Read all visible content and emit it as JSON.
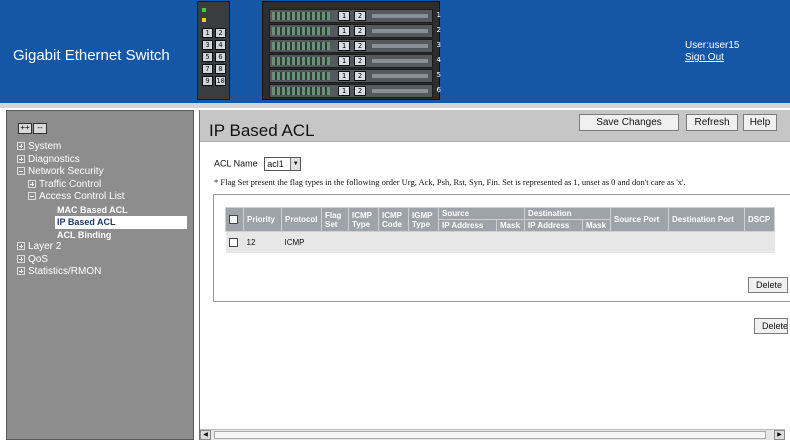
{
  "header": {
    "app_title": "Gigabit Ethernet Switch",
    "user_label": "User:user15",
    "sign_out": "Sign Out",
    "small_switch_ports": [
      "1",
      "2",
      "3",
      "4",
      "5",
      "6",
      "7",
      "8",
      "9",
      "10"
    ],
    "big_switch_slots": [
      "1",
      "2",
      "3",
      "4",
      "5",
      "6"
    ]
  },
  "nav": {
    "expand_all": "++",
    "collapse_all": "--",
    "items": [
      {
        "label": "System",
        "level": 0,
        "expander": "plus"
      },
      {
        "label": "Diagnostics",
        "level": 0,
        "expander": "plus"
      },
      {
        "label": "Network Security",
        "level": 0,
        "expander": "minus"
      },
      {
        "label": "Traffic Control",
        "level": 1,
        "expander": "plus"
      },
      {
        "label": "Access Control List",
        "level": 1,
        "expander": "minus"
      },
      {
        "label": "MAC Based ACL",
        "level": 2
      },
      {
        "label": "IP Based ACL",
        "level": 2,
        "selected": true
      },
      {
        "label": "ACL Binding",
        "level": 2
      },
      {
        "label": "Layer 2",
        "level": 0,
        "expander": "plus"
      },
      {
        "label": "QoS",
        "level": 0,
        "expander": "plus"
      },
      {
        "label": "Statistics/RMON",
        "level": 0,
        "expander": "plus"
      }
    ]
  },
  "main": {
    "page_title": "IP Based ACL",
    "buttons": {
      "save": "Save Changes",
      "refresh": "Refresh",
      "help": "Help"
    },
    "acl_name_label": "ACL Name",
    "acl_name_value": "acl1",
    "note": "* Flag Set present the flag types in the following order Urg, Ack, Psh, Rst, Syn, Fin. Set is represented as 1, unset as 0 and don't care as 'x'.",
    "table": {
      "headers": {
        "priority": "Priority",
        "protocol": "Protocol",
        "flag_set": "Flag Set",
        "icmp_type": "ICMP Type",
        "icmp_code": "ICMP Code",
        "igmp_type": "IGMP Type",
        "source": "Source",
        "destination": "Destination",
        "source_port": "Source Port",
        "destination_port": "Destination Port",
        "dscp": "DSCP",
        "src_ip": "IP Address",
        "src_mask": "Mask",
        "dst_ip": "IP Address",
        "dst_mask": "Mask"
      },
      "rows": [
        {
          "priority": "12",
          "protocol": "ICMP",
          "flag_set": "",
          "icmp_type": "",
          "icmp_code": "",
          "igmp_type": "",
          "src_ip": "",
          "src_mask": "",
          "dst_ip": "",
          "dst_mask": "",
          "source_port": "",
          "destination_port": "",
          "dscp": ""
        }
      ]
    },
    "delete_rule_button": "Delete",
    "delete_acl_button": "Delete"
  },
  "colors": {
    "header_bg": "#1557a6",
    "nav_bg": "#8d8d8d",
    "titlebar_bg": "#c6c6c6",
    "table_header_bg": "#9da3a9",
    "table_row_bg": "#e7e7e7"
  }
}
